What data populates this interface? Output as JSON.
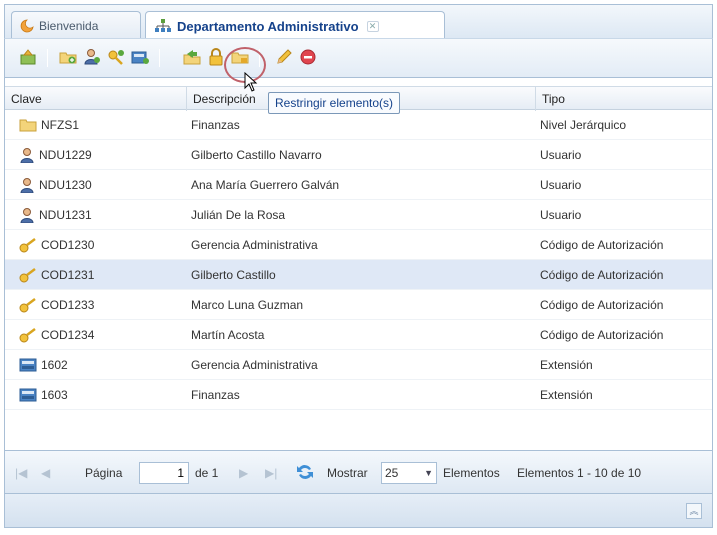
{
  "tabs": [
    {
      "label": "Bienvenida",
      "icon": "moon-icon"
    },
    {
      "label": "Departamento Administrativo",
      "icon": "org-chart-icon"
    }
  ],
  "tooltip": "Restringir elemento(s)",
  "grid": {
    "columns": [
      "Clave",
      "Descripción",
      "Tipo"
    ],
    "rows": [
      {
        "clave": "NFZS1",
        "descripcion": "Finanzas",
        "tipo": "Nivel Jerárquico",
        "icon": "folder-icon"
      },
      {
        "clave": "NDU1229",
        "descripcion": "Gilberto Castillo Navarro",
        "tipo": "Usuario",
        "icon": "user-icon"
      },
      {
        "clave": "NDU1230",
        "descripcion": "Ana María Guerrero Galván",
        "tipo": "Usuario",
        "icon": "user-icon"
      },
      {
        "clave": "NDU1231",
        "descripcion": "Julián De la Rosa",
        "tipo": "Usuario",
        "icon": "user-icon"
      },
      {
        "clave": "COD1230",
        "descripcion": "Gerencia Administrativa",
        "tipo": "Código de Autorización",
        "icon": "key-icon"
      },
      {
        "clave": "COD1231",
        "descripcion": "Gilberto Castillo",
        "tipo": "Código de Autorización",
        "icon": "key-icon"
      },
      {
        "clave": "COD1233",
        "descripcion": "Marco Luna Guzman",
        "tipo": "Código de Autorización",
        "icon": "key-icon"
      },
      {
        "clave": "COD1234",
        "descripcion": "Martín Acosta",
        "tipo": "Código de Autorización",
        "icon": "key-icon"
      },
      {
        "clave": "1602",
        "descripcion": "Gerencia Administrativa",
        "tipo": "Extensión",
        "icon": "phone-extension-icon"
      },
      {
        "clave": "1603",
        "descripcion": "Finanzas",
        "tipo": "Extensión",
        "icon": "phone-extension-icon"
      }
    ],
    "selected_row": 5
  },
  "paging": {
    "page_label": "Página",
    "page_value": "1",
    "of_label": "de 1",
    "show_label": "Mostrar",
    "page_size": "25",
    "elements_label": "Elementos",
    "summary": "Elementos 1 - 10 de 10"
  },
  "colors": {
    "header_text": "#15428b",
    "selected_row": "#dfe8f6",
    "border": "#a9bfd6",
    "highlight_ring": "#c0616a"
  }
}
